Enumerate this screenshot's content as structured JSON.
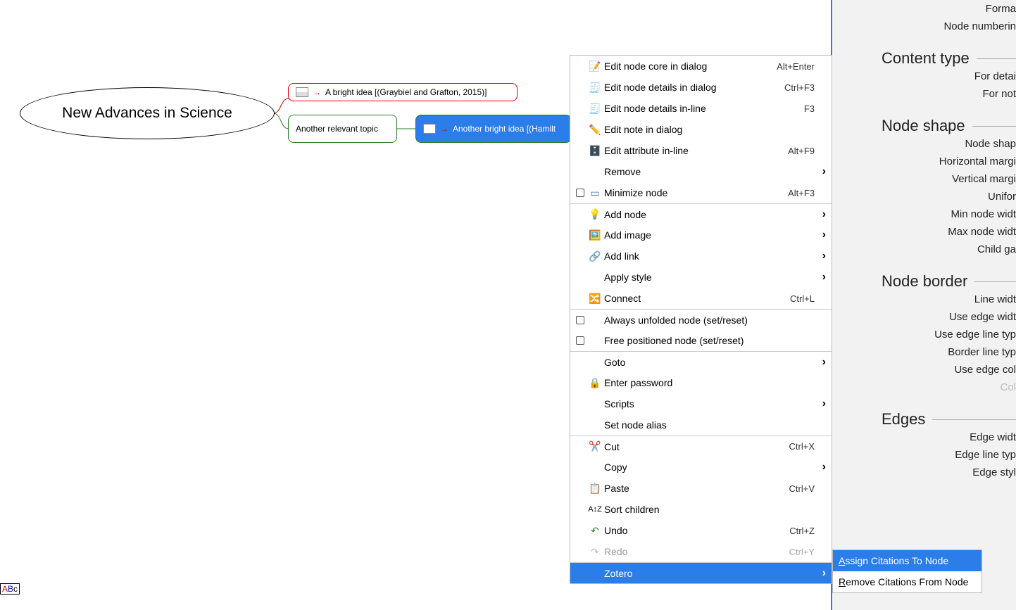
{
  "mindmap": {
    "root_label": "New Advances in Science",
    "child1_label": "A bright idea [(Graybiel and Grafton, 2015)]",
    "child2_label": "Another relevant topic",
    "child3_label": "Another bright idea [(Hamilt"
  },
  "status": {
    "abc": "ABc"
  },
  "ctx": {
    "edit_core": "Edit node core in dialog",
    "edit_core_sc": "Alt+Enter",
    "edit_details_dlg": "Edit node details in dialog",
    "edit_details_dlg_sc": "Ctrl+F3",
    "edit_details_inline": "Edit node details in-line",
    "edit_details_inline_sc": "F3",
    "edit_note": "Edit note in dialog",
    "edit_attr": "Edit attribute in-line",
    "edit_attr_sc": "Alt+F9",
    "remove": "Remove",
    "minimize": "Minimize node",
    "minimize_sc": "Alt+F3",
    "add_node": "Add node",
    "add_image": "Add image",
    "add_link": "Add link",
    "apply_style": "Apply style",
    "connect": "Connect",
    "connect_sc": "Ctrl+L",
    "always_unfolded": "Always unfolded node (set/reset)",
    "free_positioned": "Free positioned node (set/reset)",
    "goto": "Goto",
    "enter_password": "Enter password",
    "scripts": "Scripts",
    "set_alias": "Set node alias",
    "cut": "Cut",
    "cut_sc": "Ctrl+X",
    "copy": "Copy",
    "paste": "Paste",
    "paste_sc": "Ctrl+V",
    "sort": "Sort children",
    "undo": "Undo",
    "undo_sc": "Ctrl+Z",
    "redo": "Redo",
    "redo_sc": "Ctrl+Y",
    "zotero": "Zotero"
  },
  "zotero_sub": {
    "assign": "Assign Citations To Node",
    "remove": "Remove Citations From Node"
  },
  "side": {
    "top1": "Forma",
    "top2": "Node numberin",
    "content_type_hdr": "Content type",
    "for_details": "For detai",
    "for_not": "For not",
    "node_shape_hdr": "Node shape",
    "node_shap": "Node shap",
    "h_margin": "Horizontal margi",
    "v_margin": "Vertical margi",
    "uniform": "Unifor",
    "min_w": "Min node widt",
    "max_w": "Max node widt",
    "child_gap": "Child ga",
    "node_border_hdr": "Node border",
    "line_widt": "Line widt",
    "use_edge_widt": "Use edge widt",
    "use_edge_line": "Use edge line typ",
    "border_line_typ": "Border line typ",
    "use_edge_col": "Use edge col",
    "col": "Col",
    "edges_hdr": "Edges",
    "edge_widt": "Edge widt",
    "edge_line_typ": "Edge line typ",
    "edge_styl": "Edge styl"
  }
}
